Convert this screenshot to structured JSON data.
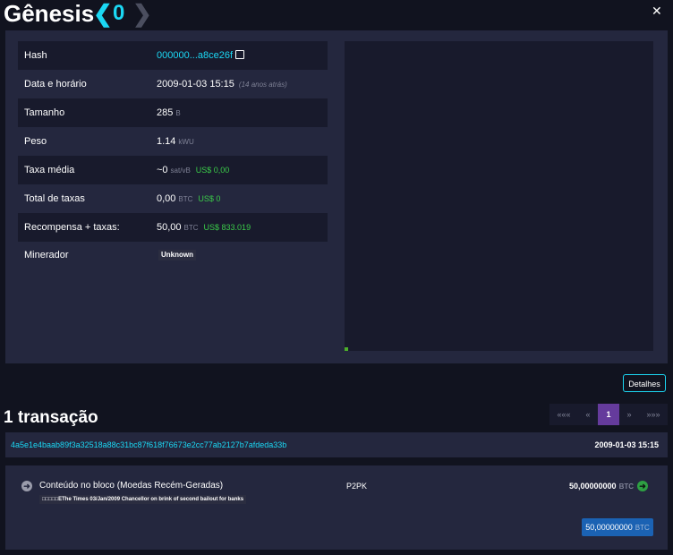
{
  "header": {
    "title": "Gênesis",
    "prev_arrow": "❮",
    "block_height": "0",
    "next_arrow": "❯",
    "close": "✕"
  },
  "details": [
    {
      "label": "Hash",
      "value": "000000...a8ce26f",
      "unit": "",
      "usd": "",
      "note": ""
    },
    {
      "label": "Data e horário",
      "value": "2009-01-03 15:15",
      "unit": "",
      "usd": "",
      "note": "(14 anos atrás)"
    },
    {
      "label": "Tamanho",
      "value": "285",
      "unit": "B",
      "usd": "",
      "note": ""
    },
    {
      "label": "Peso",
      "value": "1.14",
      "unit": "kWU",
      "usd": "",
      "note": ""
    },
    {
      "label": "Taxa média",
      "value": "~0",
      "unit": "sat/vB",
      "usd": "US$ 0,00",
      "note": ""
    },
    {
      "label": "Total de taxas",
      "value": "0,00",
      "unit": "BTC",
      "usd": "US$ 0",
      "note": ""
    },
    {
      "label": "Recompensa + taxas:",
      "value": "50,00",
      "unit": "BTC",
      "usd": "US$ 833.019",
      "note": ""
    },
    {
      "label": "Minerador",
      "value": "Unknown",
      "unit": "",
      "usd": "",
      "note": ""
    }
  ],
  "details_button": "Detalhes",
  "transactions": {
    "count_label": "1 transação",
    "pagination": [
      "«««",
      "«",
      "1",
      "»",
      "»»»"
    ],
    "active_page": "1",
    "tx": {
      "txid": "4a5e1e4baab89f3a32518a88c31bc87f618f76673e2cc77ab2127b7afdeda33b",
      "time": "2009-01-03 15:15",
      "input_title": "Conteúdo no bloco (Moedas Recém-Geradas)",
      "coinbase_text": "□□□□□EThe Times 03/Jan/2009 Chancellor on brink of second bailout for banks",
      "output_type": "P2PK",
      "output_amount": "50,00000000",
      "output_unit": "BTC",
      "total_amount": "50,00000000",
      "total_unit": "BTC"
    }
  },
  "colors": {
    "accent": "#1bd8f4",
    "usd_green": "#3bcc49",
    "panel": "#24273e",
    "row_dark": "#181a2c",
    "background": "#11131f",
    "page_active": "#653b9c",
    "total_badge": "#1b62b3"
  },
  "icons": {
    "copy": "copy-icon",
    "input": "arrow-right-circle-icon",
    "output": "arrow-right-green-circle-icon"
  }
}
